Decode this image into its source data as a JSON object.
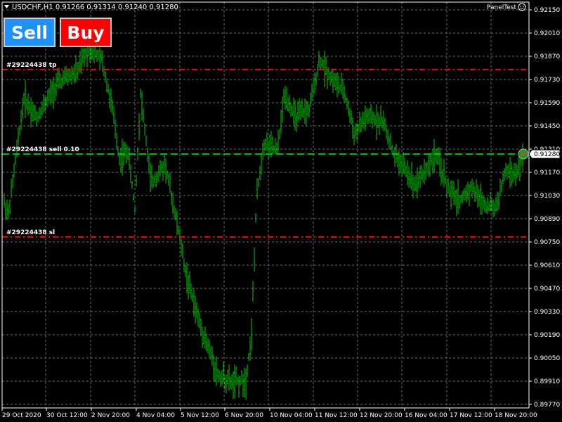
{
  "header": {
    "symbol_line": "USDCHF,H1  0.91266 0.91314 0.91240 0.91280",
    "expert_name": "PanelTest"
  },
  "buttons": {
    "sell": "Sell",
    "buy": "Buy"
  },
  "price_axis": {
    "ticks": [
      "0.92150",
      "0.92010",
      "0.91870",
      "0.91730",
      "0.91590",
      "0.91450",
      "0.91310",
      "0.91170",
      "0.91030",
      "0.90890",
      "0.90750",
      "0.90610",
      "0.90470",
      "0.90330",
      "0.90190",
      "0.90050",
      "0.89910",
      "0.89770"
    ]
  },
  "time_axis": {
    "ticks": [
      "29 Oct 2020",
      "30 Oct 12:00",
      "2 Nov 20:00",
      "4 Nov 04:00",
      "5 Nov 12:00",
      "6 Nov 20:00",
      "10 Nov 04:00",
      "11 Nov 12:00",
      "12 Nov 20:00",
      "16 Nov 04:00",
      "17 Nov 12:00",
      "18 Nov 20:00"
    ]
  },
  "current_price": "0.91280",
  "order_lines": {
    "tp": {
      "label": "#29224438 tp",
      "price": 0.9179
    },
    "entry": {
      "label": "#29224438 sell 0.10",
      "price": 0.9128
    },
    "sl": {
      "label": "#29224438 sl",
      "price": 0.9078
    }
  },
  "colors": {
    "candles": "#00c800",
    "grid": "#6b6b6b",
    "sl_tp": "#ff0000",
    "entry": "#00c800",
    "axis_text": "#ffffff"
  },
  "chart_data": {
    "type": "line",
    "title": "USDCHF,H1",
    "ylim": [
      0.8977,
      0.9219
    ],
    "x": [
      "29 Oct 2020",
      "30 Oct 12:00",
      "2 Nov 20:00",
      "4 Nov 04:00",
      "5 Nov 12:00",
      "6 Nov 20:00",
      "10 Nov 04:00",
      "11 Nov 12:00",
      "12 Nov 20:00",
      "16 Nov 04:00",
      "17 Nov 12:00",
      "18 Nov 20:00"
    ],
    "series": [
      {
        "values": [
          0.9105,
          0.917,
          0.9185,
          0.912,
          0.908,
          0.9,
          0.9135,
          0.9178,
          0.9148,
          0.912,
          0.9105,
          0.9128
        ]
      }
    ]
  }
}
